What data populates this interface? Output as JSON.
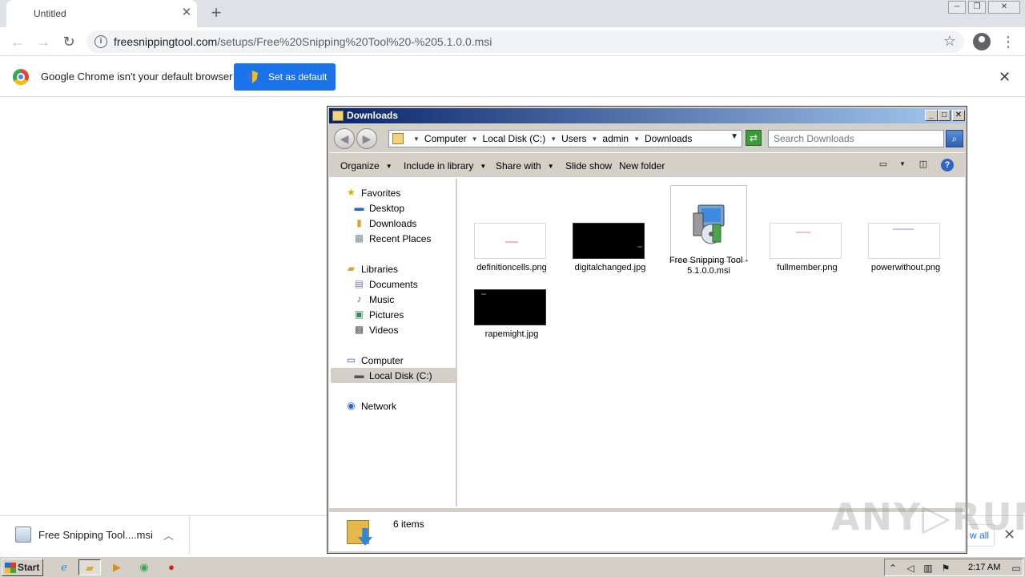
{
  "browser": {
    "tab_title": "Untitled",
    "url_host": "freesnippingtool.com",
    "url_path": "/setups/Free%20Snipping%20Tool%20-%205.1.0.0.msi",
    "infobar_text": "Google Chrome isn't your default browser",
    "set_default_label": "Set as default"
  },
  "download": {
    "file_name": "Free Snipping Tool....msi",
    "show_all": "w all"
  },
  "explorer": {
    "title": "Downloads",
    "breadcrumbs": [
      "Computer",
      "Local Disk (C:)",
      "Users",
      "admin",
      "Downloads"
    ],
    "search_placeholder": "Search Downloads",
    "commands": [
      "Organize",
      "Include in library",
      "Share with",
      "Slide show",
      "New folder"
    ],
    "nav": {
      "favorites": "Favorites",
      "desktop": "Desktop",
      "downloads": "Downloads",
      "recent": "Recent Places",
      "libraries": "Libraries",
      "documents": "Documents",
      "music": "Music",
      "pictures": "Pictures",
      "videos": "Videos",
      "computer": "Computer",
      "local_disk": "Local Disk (C:)",
      "network": "Network"
    },
    "files": [
      {
        "name": "definitioncells.png",
        "kind": "light-image"
      },
      {
        "name": "digitalchanged.jpg",
        "kind": "dark-image"
      },
      {
        "name": "Free Snipping Tool - 5.1.0.0.msi",
        "kind": "installer"
      },
      {
        "name": "fullmember.png",
        "kind": "light-image"
      },
      {
        "name": "powerwithout.png",
        "kind": "light-image"
      },
      {
        "name": "rapemight.jpg",
        "kind": "dark-image"
      }
    ],
    "status": "6 items"
  },
  "watermark": "ANY▷RUN",
  "taskbar": {
    "start_label": "Start",
    "clock": "2:17 AM"
  },
  "colors": {
    "chrome_blue": "#1a73e8",
    "xp_title_start": "#0a246a",
    "xp_title_end": "#a6caf0",
    "classic_gray": "#d4d0c8"
  }
}
